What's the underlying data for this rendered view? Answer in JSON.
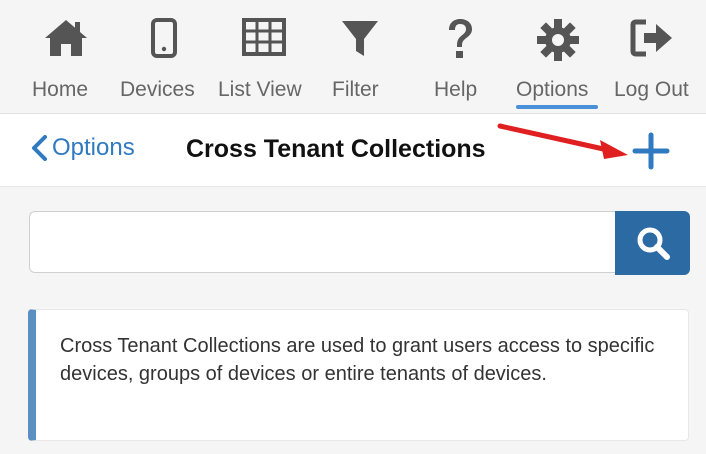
{
  "toolbar": {
    "items": [
      {
        "label": "Home",
        "icon": "home-icon"
      },
      {
        "label": "Devices",
        "icon": "phone-icon"
      },
      {
        "label": "List View",
        "icon": "grid-icon"
      },
      {
        "label": "Filter",
        "icon": "filter-icon"
      },
      {
        "label": "Help",
        "icon": "question-icon"
      },
      {
        "label": "Options",
        "icon": "gear-icon",
        "active": true
      },
      {
        "label": "Log Out",
        "icon": "logout-icon"
      }
    ],
    "active_color": "#4a90d9"
  },
  "nav": {
    "back_label": "Options",
    "title": "Cross Tenant Collections",
    "add_icon": "plus-icon"
  },
  "search": {
    "value": "",
    "button_icon": "search-icon"
  },
  "info": {
    "text": "Cross Tenant Collections are used to grant users access to specific devices, groups of devices or entire tenants of devices."
  },
  "colors": {
    "accent": "#2f7ac0",
    "search_button": "#2b6aa3",
    "annotation_arrow": "#e02020"
  }
}
